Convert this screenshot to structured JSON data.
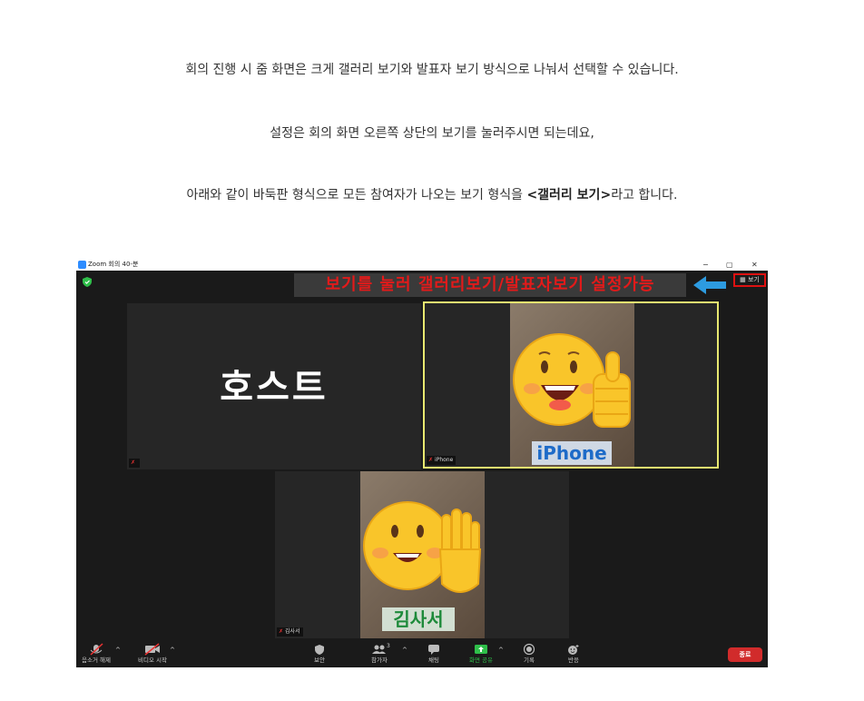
{
  "article": {
    "paragraph1": "회의 진행 시 줌 화면은 크게 갤러리 보기와 발표자 보기 방식으로 나눠서 선택할 수 있습니다.",
    "paragraph2": "설정은 회의 화면 오른쪽 상단의 보기를 눌러주시면 되는데요,",
    "paragraph3_prefix": "아래와 같이 바둑판 형식으로 모든 참여자가 나오는 보기 형식을 ",
    "paragraph3_bold": "<갤러리 보기>",
    "paragraph3_suffix": "라고 합니다."
  },
  "zoom": {
    "window_title": "Zoom 회의 40-분",
    "window_controls": {
      "minimize": "−",
      "maximize": "▢",
      "close": "✕"
    },
    "annotation_banner": "보기를 눌러 갤러리보기/발표자보기 설정가능",
    "view_button_label": "보기",
    "participants": [
      {
        "overlay_text": "호스트",
        "name_chip": ""
      },
      {
        "overlay_text": "iPhone",
        "name_chip": "iPhone"
      },
      {
        "overlay_text": "김사서",
        "name_chip": "김사서"
      }
    ],
    "toolbar": {
      "unmute": "음소거 해제",
      "start_video": "비디오 시작",
      "security": "보안",
      "participants": "참가자",
      "participants_count": "3",
      "chat": "채팅",
      "share_screen": "화면 공유",
      "record": "기록",
      "reactions": "반응",
      "end": "종료"
    }
  },
  "colors": {
    "banner_text": "#e21a1a",
    "arrow": "#2d9be0",
    "active_speaker_border": "#e8e870",
    "share_green": "#2fbf4a",
    "end_red": "#d12b2b",
    "iphone_label": "#1e6bc8",
    "kim_label": "#1d8a3a"
  }
}
